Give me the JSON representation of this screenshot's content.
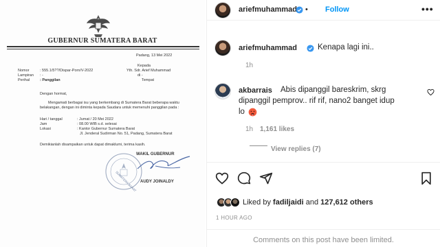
{
  "letter": {
    "title": "GUBERNUR SUMATERA BARAT",
    "place_date": "Padang, 13 Mei 2022",
    "kepada": "Kepada",
    "nomor_label": "Nomor",
    "nomor_value": ": 555.1/5??/Dispar-Porn/V-2022",
    "lampiran_label": "Lampiran",
    "lampiran_value": ": -",
    "perihal_label": "Perihal",
    "perihal_value": ": Panggilan",
    "yth": "Yth. Sdr. Arief Muhammad",
    "di": "di -",
    "tempat": "Tempat",
    "greeting": "Dengan hormat,",
    "body1": "Mengamati berbagai isu yang berkembang di Sumatera Barat beberapa waktu",
    "body2": "belakangan, dengan ini diminta kepada Saudara untuk memenuhi panggilan pada :",
    "hari_label": "Hari / tanggal",
    "hari_value": ": Jumat / 20 Mei 2022",
    "jam_label": "Jam",
    "jam_value": ": 08.00 WIB s.d. selesai",
    "lokasi_label": "Lokasi",
    "lokasi_value": ": Kantor Gubernur Sumatera Barat",
    "lokasi_value2": "Jl. Jenderal Sudirman No. 51, Padang, Sumatera Barat",
    "closing": "Demikianlah disampaikan untuk dapat dimaklumi, terima kasih.",
    "sign_title": "WAKIL GUBERNUR",
    "sign_name": "AUDY JOINALDY",
    "stamp_text": "SUMATERA BARAT"
  },
  "header": {
    "username": "ariefmuhammad",
    "follow_label": "Follow",
    "more_label": "•••"
  },
  "caption": {
    "username": "ariefmuhammad",
    "text": "Kenapa lagi ini..",
    "time": "1h"
  },
  "comment": {
    "username": "akbarrais",
    "line1": "Abis dipanggil bareskrim, skrg",
    "line2": "dipanggil pemprov.. rif rif, nano2 banget idup",
    "line3": "lo",
    "time": "1h",
    "likes": "1,161 likes",
    "view_replies": "View replies (7)"
  },
  "likes": {
    "prefix": "Liked by",
    "user": "fadiljaidi",
    "and": "and",
    "count": "127,612 others"
  },
  "timeago": "1 HOUR AGO",
  "limited": "Comments on this post have been limited.",
  "colors": {
    "link": "#0095f6",
    "verified": "#3897f0",
    "muted": "#8e8e8e"
  },
  "icons": [
    "verified-icon",
    "heart-icon",
    "comment-icon",
    "share-icon",
    "bookmark-icon",
    "emoji-icon"
  ]
}
